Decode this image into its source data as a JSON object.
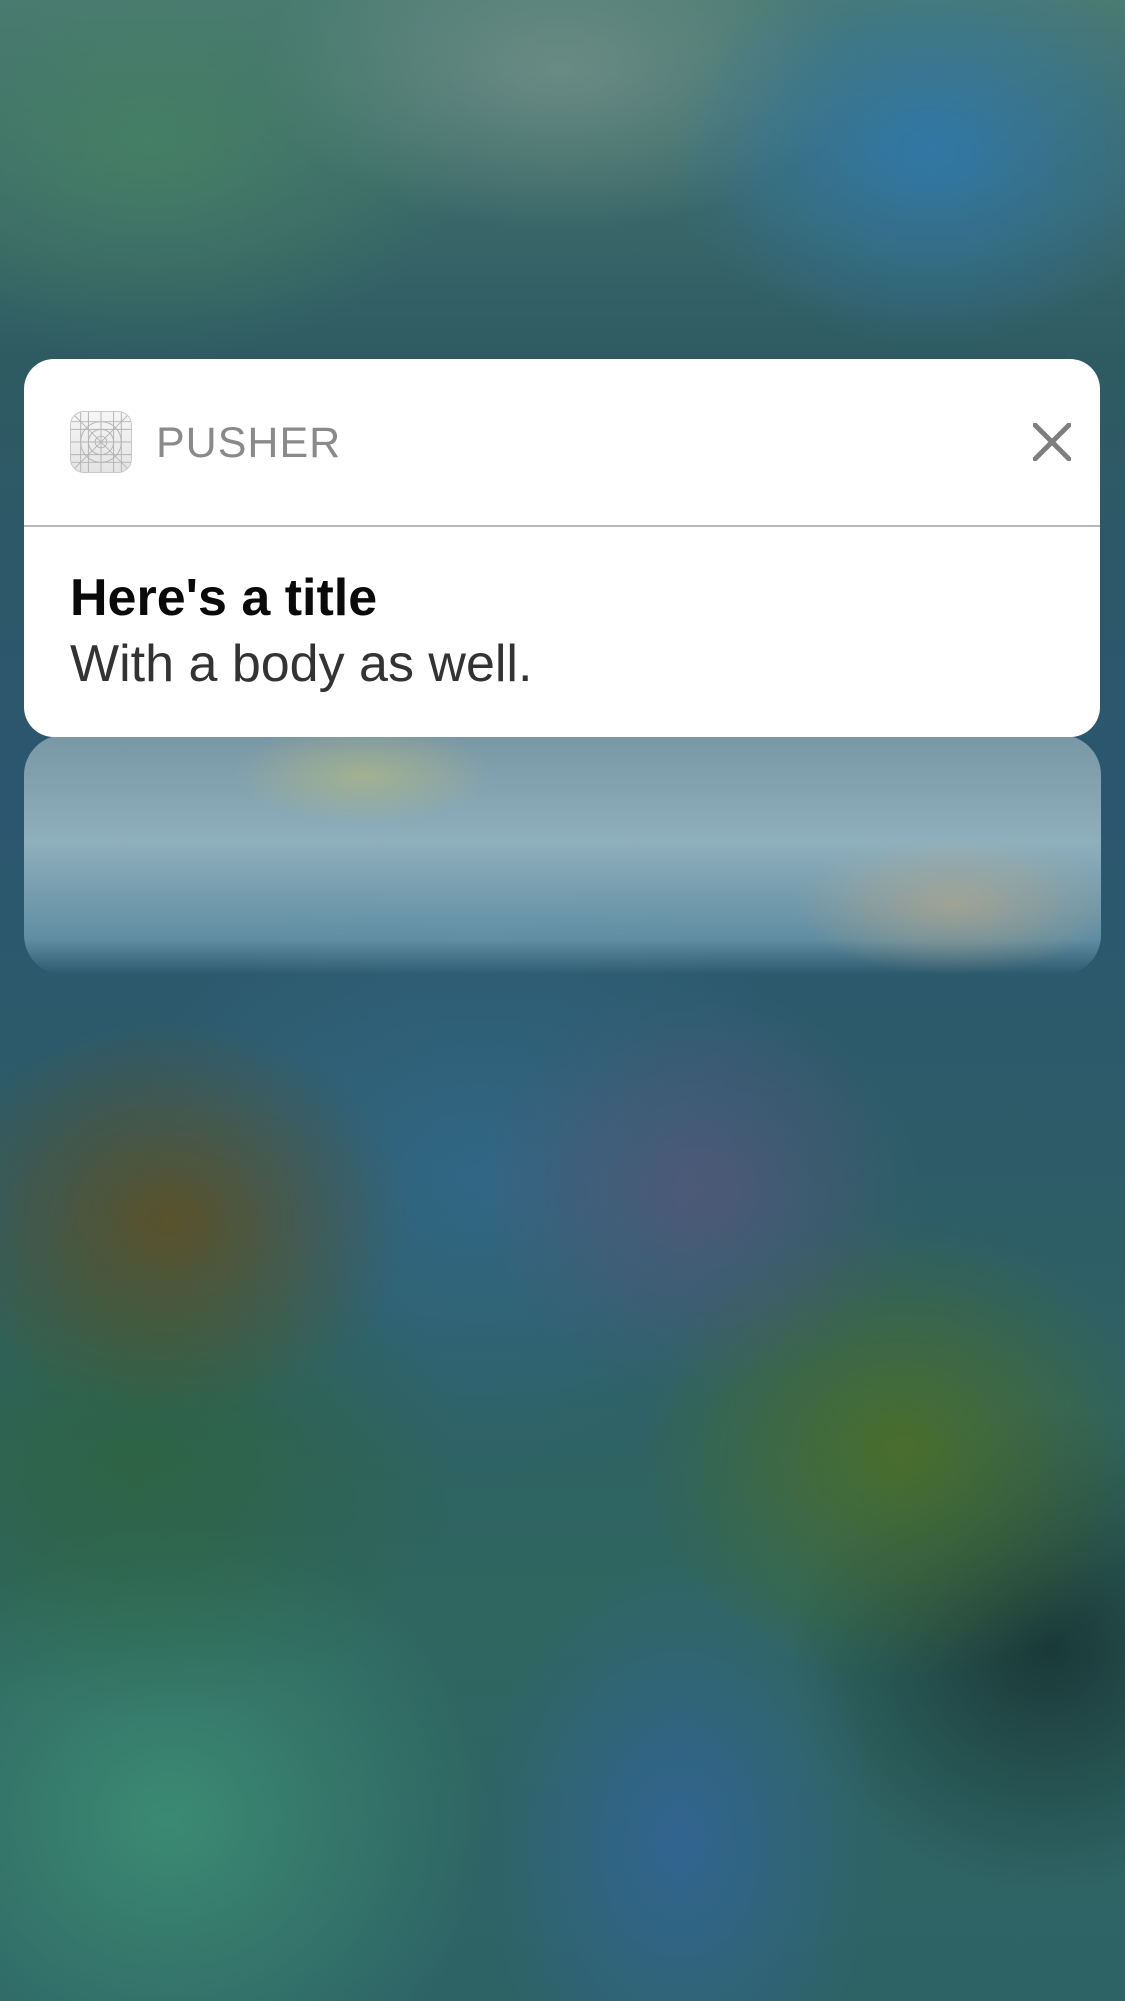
{
  "notification": {
    "app_name": "PUSHER",
    "app_icon": "app-icon-grid-template",
    "close_icon": "close-icon",
    "title": "Here's a title",
    "body": "With a body as well."
  },
  "colors": {
    "card_background": "#ffffff",
    "app_name_text": "#8a8a8a",
    "title_text": "#0a0a0a",
    "body_text": "#333333",
    "close_icon": "#7f7f7f"
  }
}
